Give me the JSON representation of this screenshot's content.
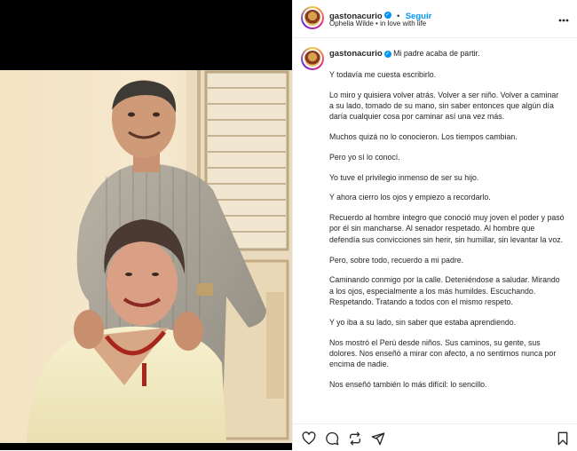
{
  "post": {
    "username": "gastonacurio",
    "follow_label": "Seguir",
    "dot": "•",
    "subline_song": "Ophelia Wilde",
    "subline_sep": "•",
    "subline_mood": "in love with life",
    "more_label": "•••"
  },
  "caption": {
    "username": "gastonacurio",
    "first_line": "Mi padre acaba de partir.",
    "paragraphs": [
      "Y todavía me cuesta escribirlo.",
      "Lo miro y quisiera volver atrás. Volver a ser niño. Volver a caminar a su lado, tomado de su mano, sin saber entonces que algún día daría cualquier cosa por caminar así una vez más.",
      "Muchos quizá no lo conocieron. Los tiempos cambian.",
      "Pero yo sí lo conocí.",
      "Yo tuve el privilegio inmenso de ser su hijo.",
      "Y ahora cierro los ojos y empiezo a recordarlo.",
      "Recuerdo al hombre íntegro que conoció muy joven el poder y pasó por él sin mancharse. Al senador respetado. Al hombre que defendía sus convicciones sin herir, sin humillar, sin levantar la voz.",
      "Pero, sobre todo, recuerdo a mi padre.",
      "Caminando conmigo por la calle. Deteniéndose a saludar. Mirando a los ojos, especialmente a los más humildes. Escuchando. Respetando. Tratando a todos con el mismo respeto.",
      "Y yo iba a su lado, sin saber que estaba aprendiendo.",
      "Nos mostró el Perú desde niños. Sus caminos, su gente, sus dolores. Nos enseñó a mirar con afecto, a no sentirnos nunca por encima de nadie.",
      "Nos enseñó también lo más difícil: lo sencillo."
    ]
  },
  "actions": {
    "icons": [
      "heart-icon",
      "comment-icon",
      "repost-icon",
      "share-icon",
      "bookmark-icon"
    ]
  },
  "colors": {
    "accent": "#0095f6",
    "text": "#262626",
    "border": "#efefef"
  }
}
